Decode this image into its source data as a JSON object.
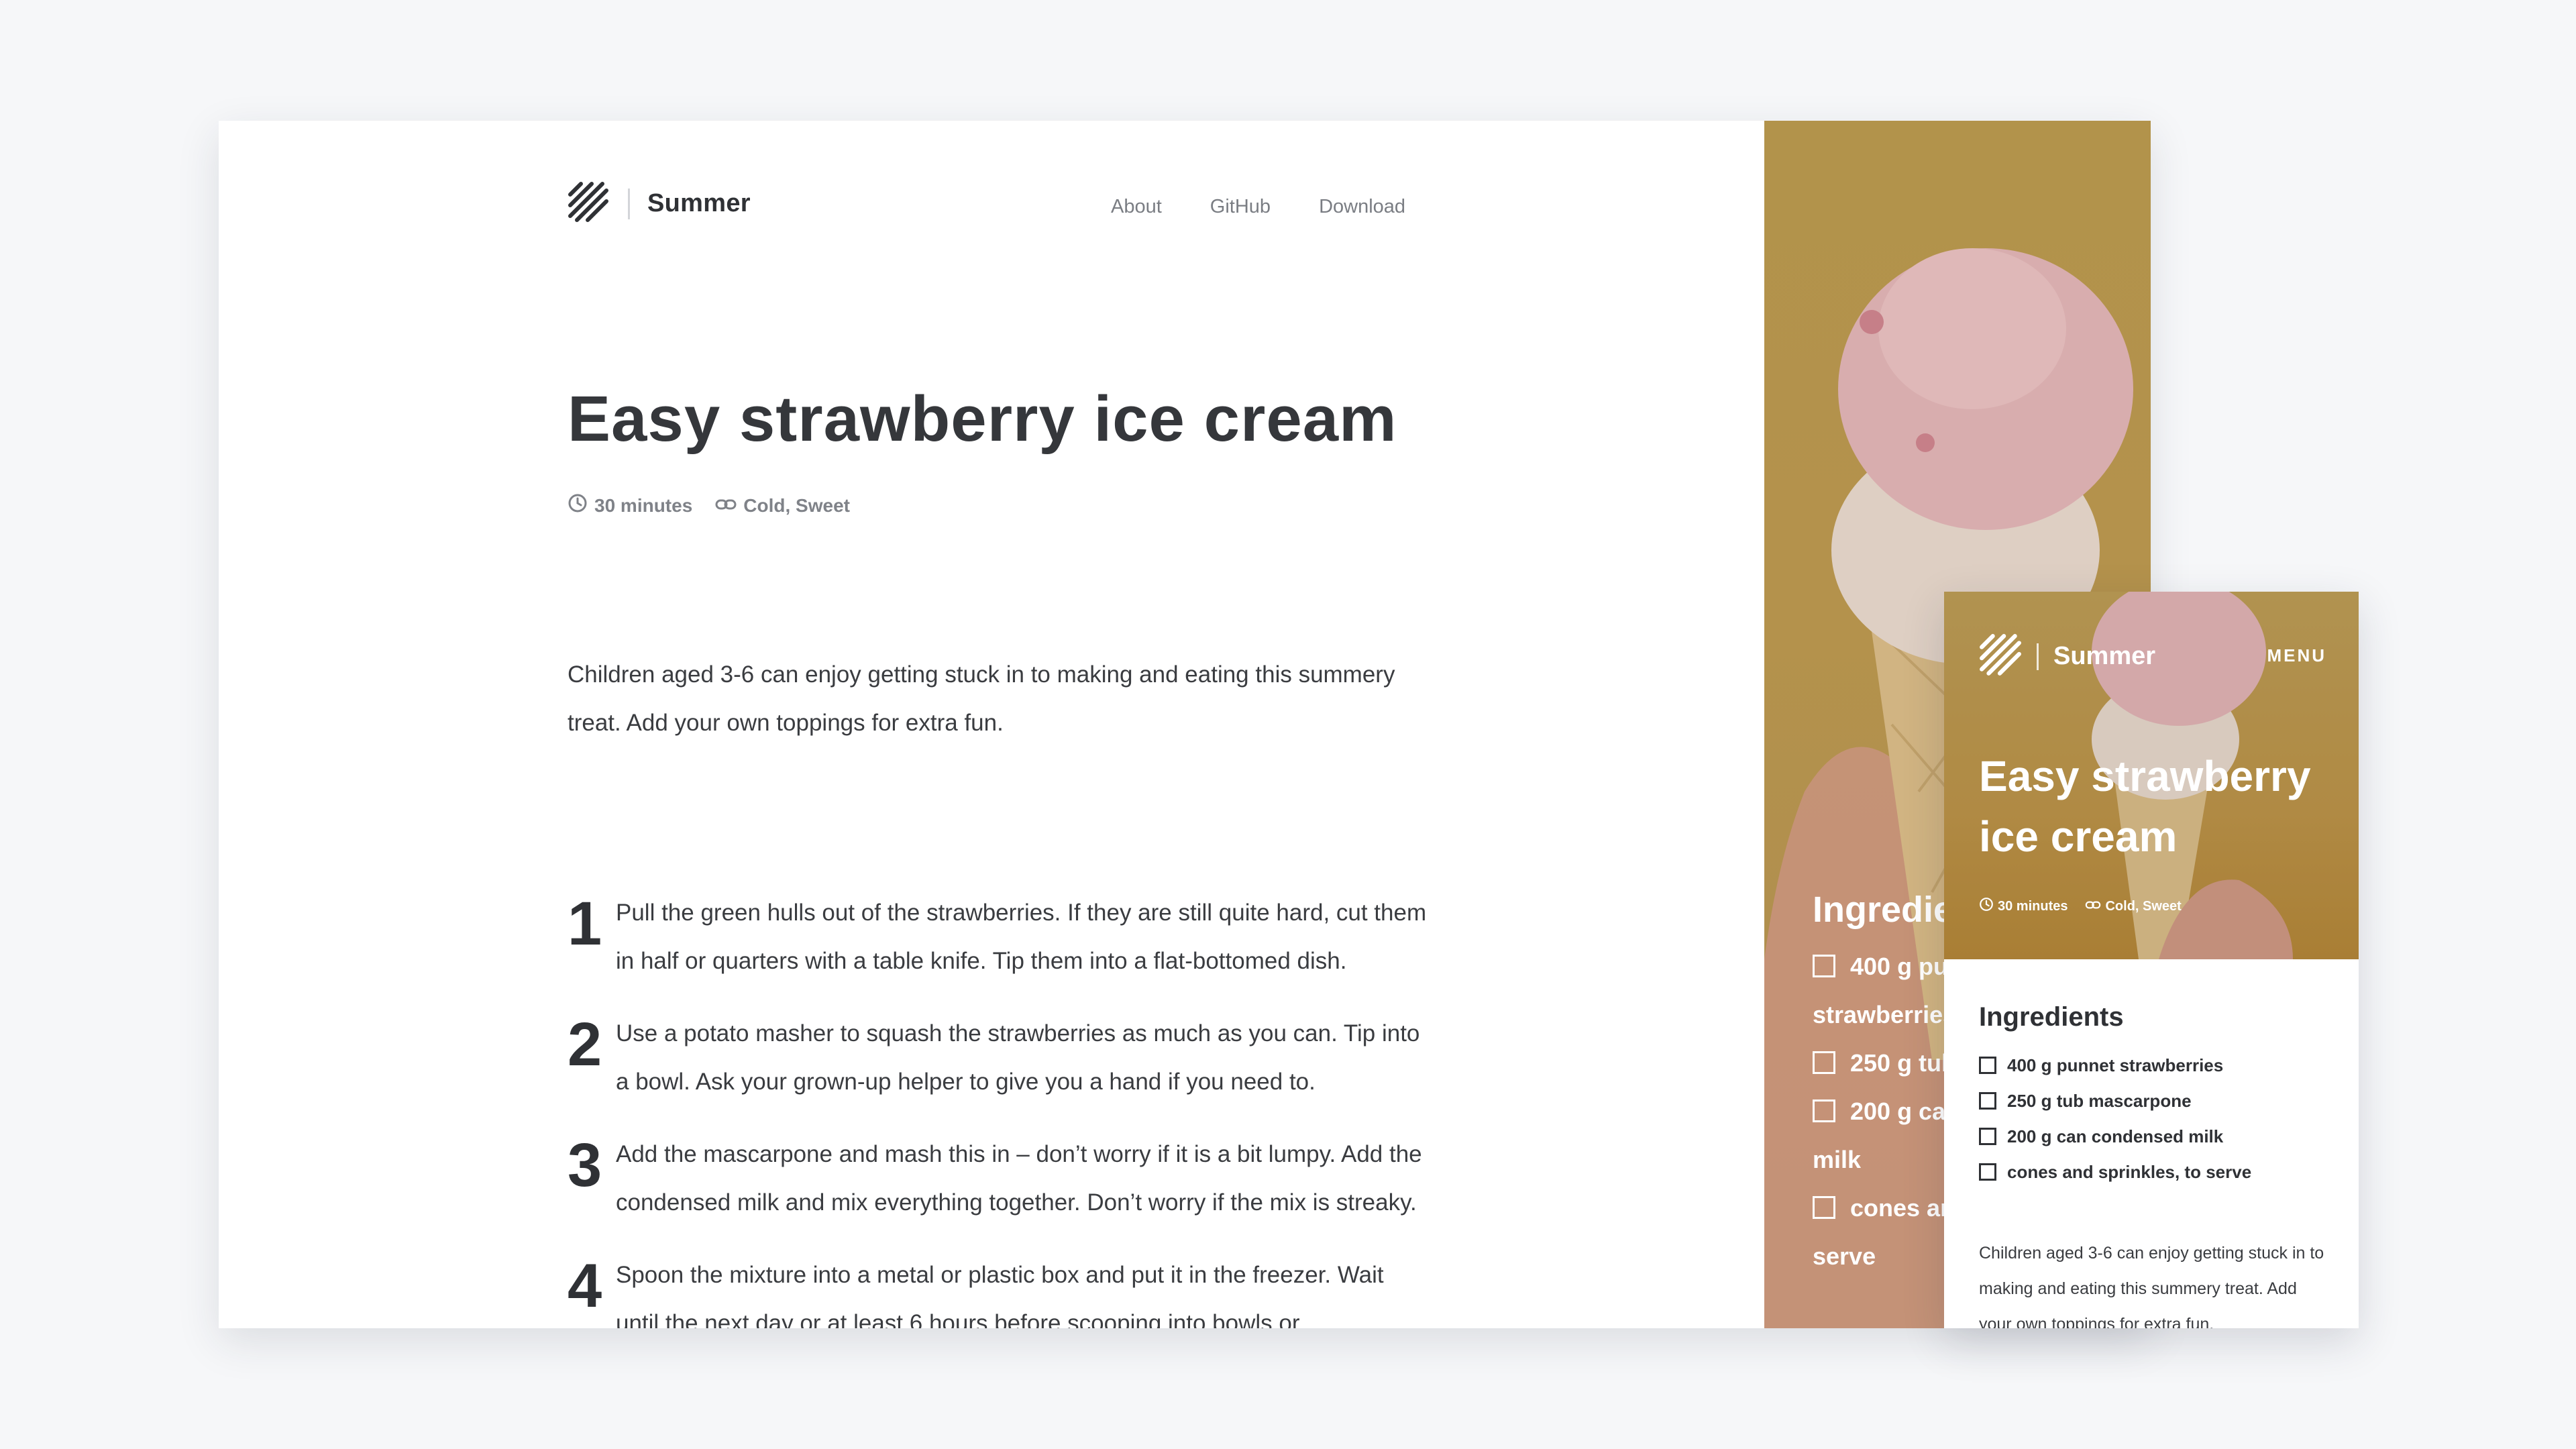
{
  "brand": {
    "name": "Summer"
  },
  "nav": {
    "items": [
      "About",
      "GitHub",
      "Download"
    ]
  },
  "recipe": {
    "title": "Easy strawberry ice cream",
    "time": "30 minutes",
    "tags": "Cold, Sweet",
    "intro": "Children aged 3-6 can enjoy getting stuck in to making and eating this summery treat. Add your own toppings for extra fun.",
    "steps": [
      {
        "num": "1",
        "text": "Pull the green hulls out of the strawberries. If they are still quite hard, cut them in half or quarters with a table knife. Tip them into a flat-bottomed dish."
      },
      {
        "num": "2",
        "text": "Use a potato masher to squash the strawberries as much as you can. Tip into a bowl. Ask your grown-up helper to give you a hand if you need to."
      },
      {
        "num": "3",
        "text": "Add the mascarpone and mash this in – don’t worry if it is a bit lumpy. Add the condensed milk and mix everything together. Don’t worry if the mix is streaky."
      },
      {
        "num": "4",
        "text": "Spoon the mixture into a metal or plastic box and put it in the freezer. Wait until the next day or at least 6 hours before scooping into bowls or"
      }
    ],
    "ingredients_title": "Ingredients",
    "ingredients": [
      "400 g punnet strawberries",
      "250 g tub mascarpone",
      "200 g can condensed milk",
      "cones and sprinkles, to serve"
    ]
  },
  "hero_panel": {
    "ingredients_title": "Ingredie",
    "ingredients": [
      "400 g pu",
      "strawberries",
      "250 g tul",
      "200 g ca",
      "milk",
      "cones an",
      "serve"
    ]
  },
  "mobile": {
    "menu_label": "MENU",
    "intro": "Children aged 3-6 can enjoy getting stuck in to making and eating this summery treat. Add your own toppings for extra fun."
  },
  "colors": {
    "hero": "#c2a052",
    "text": "#2f3135",
    "muted": "#7a7d83",
    "background": "#f6f7f9"
  },
  "icons": {
    "logo": "diagonal-stripes-logo-icon",
    "time": "clock-icon",
    "tags": "link-icon",
    "checkbox": "checkbox-icon"
  }
}
